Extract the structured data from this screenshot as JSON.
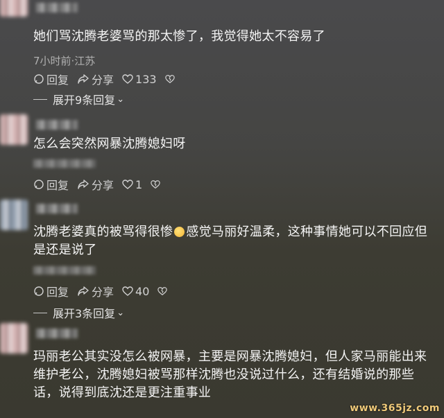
{
  "comments": [
    {
      "text": "她们骂沈腾老婆骂的那太惨了，我觉得她太不容易了",
      "meta": "7小时前·江苏",
      "reply_label": "回复",
      "share_label": "分享",
      "like_count": "133",
      "expand_label": "展开9条回复"
    },
    {
      "text": "怎么会突然网暴沈腾媳妇呀",
      "reply_label": "回复",
      "share_label": "分享",
      "like_count": "1"
    },
    {
      "text_part1": "沈腾老婆真的被骂得很惨",
      "text_part2": "感觉马丽好温柔，这种事情她可以不回应但是还是说了",
      "reply_label": "回复",
      "share_label": "分享",
      "like_count": "40",
      "expand_label": "展开3条回复"
    },
    {
      "text": "玛丽老公其实没怎么被网暴，主要是网暴沈腾媳妇，但人家马丽能出来维护老公，沈腾媳妇被骂那样沈腾也没说过什么，还有结婚说的那些话，说得到底沈还是更注重事业"
    }
  ],
  "watermark": "www.365jz.com",
  "icons": {
    "reply": "comment-icon",
    "share": "share-icon",
    "like": "heart-icon",
    "dislike": "broken-heart-icon"
  }
}
